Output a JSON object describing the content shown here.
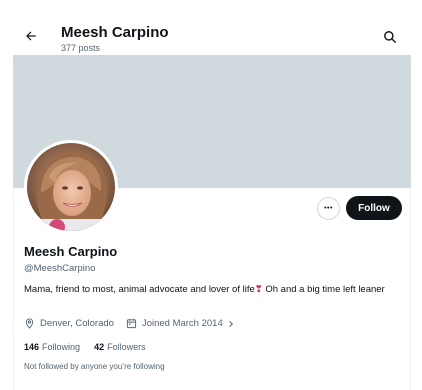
{
  "header": {
    "title": "Meesh Carpino",
    "posts": "377 posts"
  },
  "profile": {
    "name": "Meesh Carpino",
    "handle": "@MeeshCarpino",
    "bio_before": "Mama, friend to most, animal advocate and lover of life",
    "bio_emoji": "❣",
    "bio_after": " Oh and a big time left leaner",
    "location": "Denver, Colorado",
    "joined": "Joined March 2014",
    "following_count": "146",
    "following_label": "Following",
    "followers_count": "42",
    "followers_label": "Followers",
    "not_followed": "Not followed by anyone you’re following"
  },
  "actions": {
    "follow_label": "Follow",
    "more_label": "•••"
  },
  "colors": {
    "banner": "#cfd9de",
    "follow_bg": "#0f1419",
    "muted_text": "#536471",
    "heart": "#e0245e"
  },
  "icons": [
    "back-arrow-icon",
    "search-icon",
    "more-icon",
    "location-icon",
    "calendar-icon",
    "chevron-right-icon"
  ]
}
